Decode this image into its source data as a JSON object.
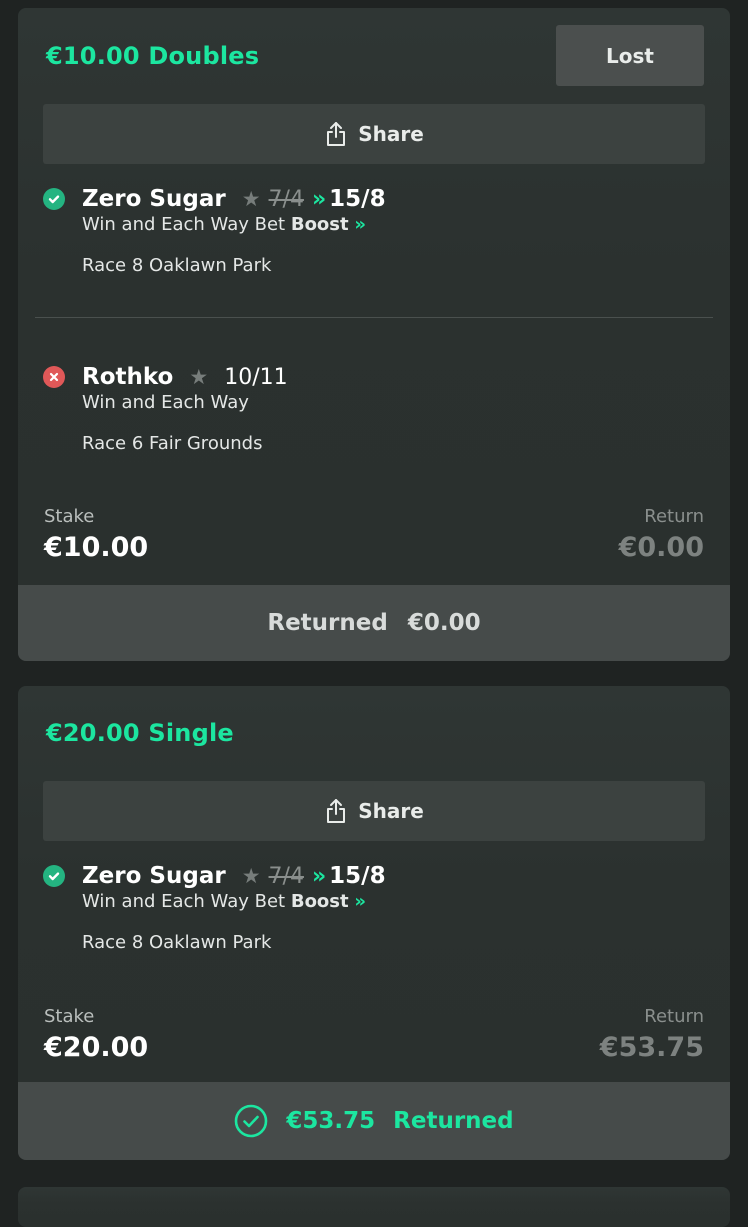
{
  "bets": [
    {
      "title": "€10.00 Doubles",
      "status": "Lost",
      "share_label": "Share",
      "selections": [
        {
          "result": "win",
          "name": "Zero Sugar",
          "old_odds": "7/4",
          "new_odds": "15/8",
          "market": "Win and Each Way",
          "boost_prefix": "Bet",
          "boost_word": "Boost",
          "race": "Race 8 Oaklawn Park"
        },
        {
          "result": "loss",
          "name": "Rothko",
          "odds": "10/11",
          "market": "Win and Each Way",
          "race": "Race 6 Fair Grounds"
        }
      ],
      "stake_label": "Stake",
      "stake_value": "€10.00",
      "return_label": "Return",
      "return_value": "€0.00",
      "footer_label": "Returned",
      "footer_value": "€0.00"
    },
    {
      "title": "€20.00 Single",
      "share_label": "Share",
      "selections": [
        {
          "result": "win",
          "name": "Zero Sugar",
          "old_odds": "7/4",
          "new_odds": "15/8",
          "market": "Win and Each Way",
          "boost_prefix": "Bet",
          "boost_word": "Boost",
          "race": "Race 8 Oaklawn Park"
        }
      ],
      "stake_label": "Stake",
      "stake_value": "€20.00",
      "return_label": "Return",
      "return_value": "€53.75",
      "footer_value": "€53.75",
      "footer_label": "Returned"
    }
  ],
  "icons": {
    "win": "check-circle-icon",
    "loss": "x-circle-icon",
    "share": "share-icon",
    "star": "star-icon",
    "boost": "double-chevron-right-icon"
  },
  "colors": {
    "accent": "#1ce6a0",
    "win": "#24b481",
    "loss": "#e05858",
    "card": "#2f3634",
    "background": "#1f2322"
  }
}
